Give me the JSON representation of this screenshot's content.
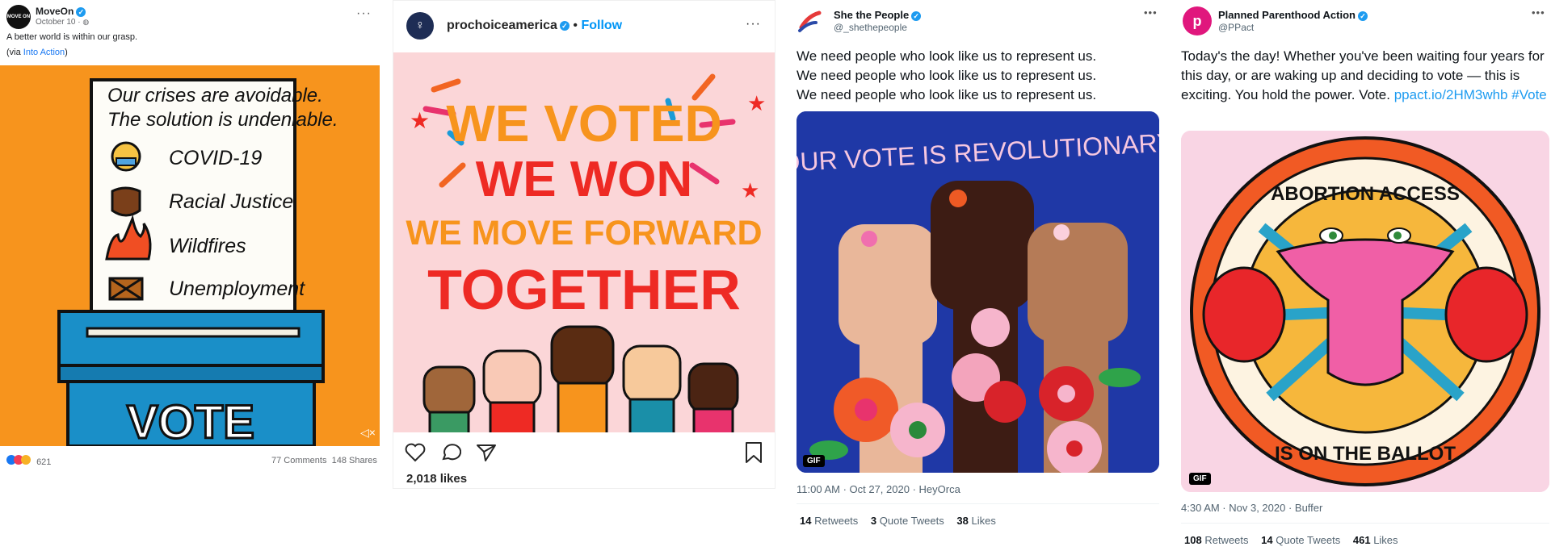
{
  "facebook_post": {
    "author": "MoveOn",
    "avatar_text": "MOVE ON",
    "date": "October 10 ·",
    "text": "A better world is within our grasp.",
    "via_prefix": "(via ",
    "via_link": "Into Action",
    "via_suffix": ")",
    "image": {
      "line1": "Our crises are avoidable.",
      "line2": "The solution is undeniable.",
      "items": [
        "COVID-19",
        "Racial Justice",
        "Wildfires",
        "Unemployment"
      ],
      "box_label": "VOTE"
    },
    "reaction_count": "621",
    "comments": "77 Comments",
    "shares": "148 Shares",
    "colors": {
      "background": "#f7941d",
      "box": "#1a8fc8"
    }
  },
  "instagram_post": {
    "username": "prochoiceamerica",
    "follow": "Follow",
    "image": {
      "line1": "WE VOTED",
      "line2": "WE WON",
      "line3": "WE MOVE FORWARD",
      "line4": "TOGETHER"
    },
    "likes": "2,018 likes",
    "icons": [
      "heart-icon",
      "comment-icon",
      "share-icon",
      "bookmark-icon"
    ]
  },
  "tweet1": {
    "name": "She the People",
    "handle": "@_shethepeople",
    "lines": [
      "We need people who look like us to represent us.",
      "We need people who look like us to represent us.",
      "We need people who look like us to represent us."
    ],
    "image_title": "OUR VOTE IS REVOLUTIONARY",
    "gif_badge": "GIF",
    "meta": "11:00 AM · Oct 27, 2020 · HeyOrca",
    "retweets_n": "14",
    "retweets_l": "Retweets",
    "quotes_n": "3",
    "quotes_l": "Quote Tweets",
    "likes_n": "38",
    "likes_l": "Likes"
  },
  "tweet2": {
    "name": "Planned Parenthood Action",
    "handle": "@PPact",
    "text": "Today's the day! Whether you've been waiting four years for this day, or are waking up and deciding to vote — this is exciting. You hold the power. Vote.",
    "link": "ppact.io/2HM3whb",
    "hashtag": "#Vote",
    "image_top": "ABORTION ACCESS",
    "image_bottom": "IS ON THE BALLOT",
    "gif_badge": "GIF",
    "meta": "4:30 AM · Nov 3, 2020 · Buffer",
    "retweets_n": "108",
    "retweets_l": "Retweets",
    "quotes_n": "14",
    "quotes_l": "Quote Tweets",
    "likes_n": "461",
    "likes_l": "Likes"
  }
}
